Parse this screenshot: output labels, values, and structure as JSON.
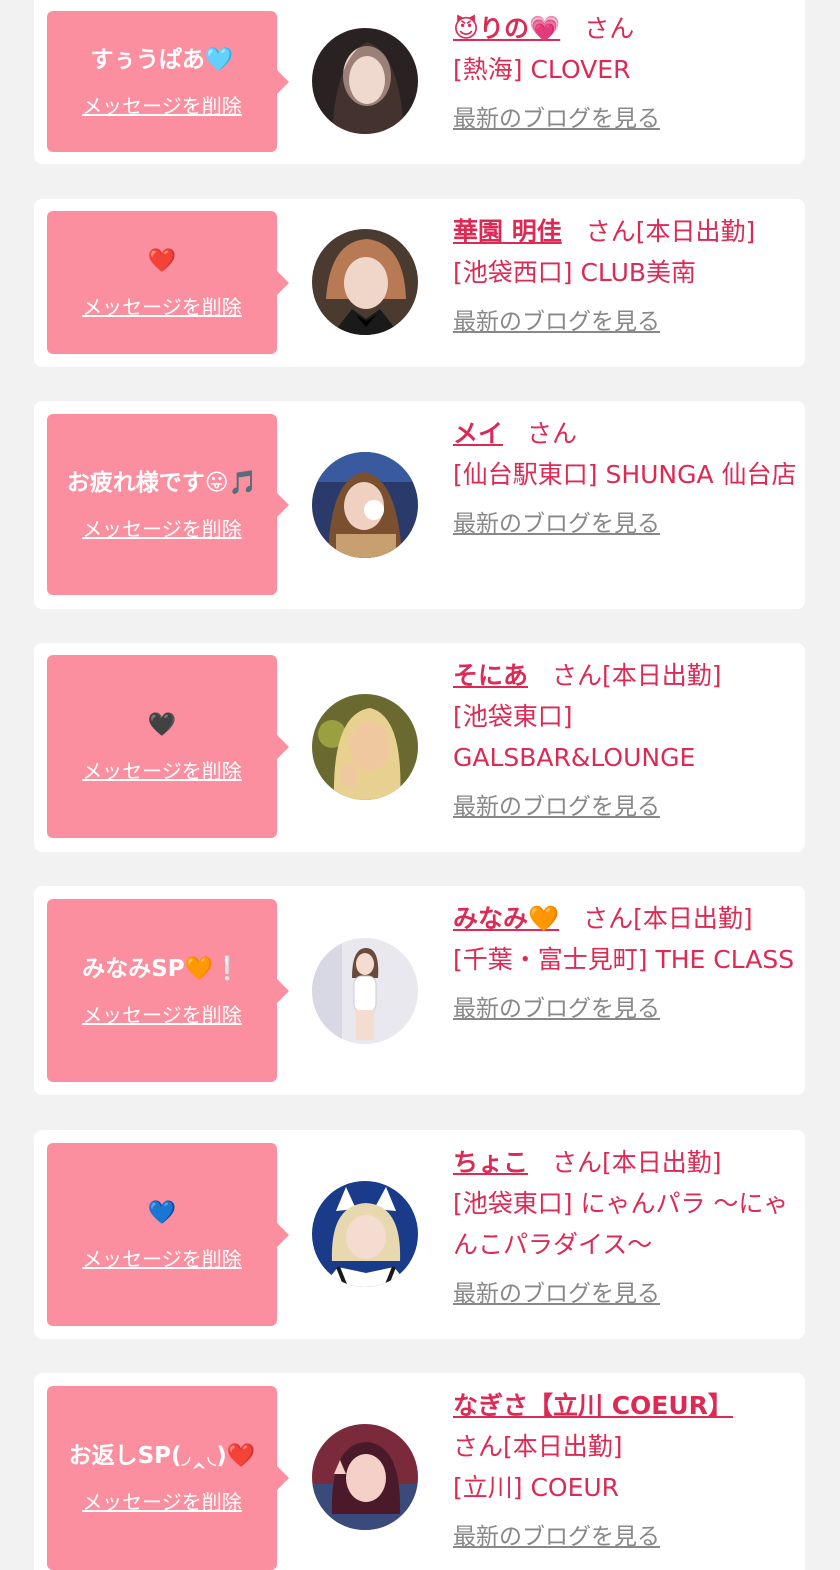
{
  "common": {
    "delete_label": "メッセージを削除",
    "blog_label": "最新のブログを見る",
    "san": "さん"
  },
  "colors": {
    "bubble": "#fb8fa0",
    "accent": "#dc2a55",
    "link_gray": "#888888",
    "background": "#f2f2f2"
  },
  "items": [
    {
      "message": "すぅうぱあ🩵",
      "name": "😈りの💗",
      "status": "",
      "shop": "[熱海] CLOVER",
      "avatar_palette": [
        "#2a2222",
        "#e8cfc3",
        "#5a4038"
      ]
    },
    {
      "message": "❤️",
      "name": "華園 明佳",
      "status": "[本日出勤]",
      "shop": "[池袋西口] CLUB美南",
      "avatar_palette": [
        "#4a3a30",
        "#f0d6c8",
        "#b87a55"
      ]
    },
    {
      "message": "お疲れ様です😛🎵",
      "name": "メイ",
      "status": "",
      "shop": "[仙台駅東口] SHUNGA 仙台店",
      "avatar_palette": [
        "#2a3a6a",
        "#f0d0c0",
        "#7a5030"
      ]
    },
    {
      "message": "🖤",
      "name": "そにあ",
      "status": "[本日出勤]",
      "shop": "[池袋東口] GALSBAR&LOUNGE",
      "avatar_palette": [
        "#6a6a30",
        "#f0c8a0",
        "#e8d090"
      ]
    },
    {
      "message": "みなみSP🧡❕",
      "name": "みなみ🧡",
      "status": "[本日出勤]",
      "shop": "[千葉・富士見町] THE CLASS",
      "avatar_palette": [
        "#e8e8ee",
        "#f4dcd0",
        "#d8d8de"
      ]
    },
    {
      "message": "💙",
      "name": "ちょこ",
      "status": "[本日出勤]",
      "shop": "[池袋東口] にゃんパラ 〜にゃんこパラダイス〜",
      "avatar_palette": [
        "#1a3a8a",
        "#f4dcd0",
        "#e8d8b0"
      ]
    },
    {
      "message": "お返しSP(◞‸◟)❤️",
      "name": "なぎさ【立川 COEUR】",
      "status": "[本日出勤]",
      "shop": "[立川] COEUR",
      "avatar_palette": [
        "#7a2a3a",
        "#f4d0c8",
        "#4a1a2a"
      ]
    }
  ]
}
